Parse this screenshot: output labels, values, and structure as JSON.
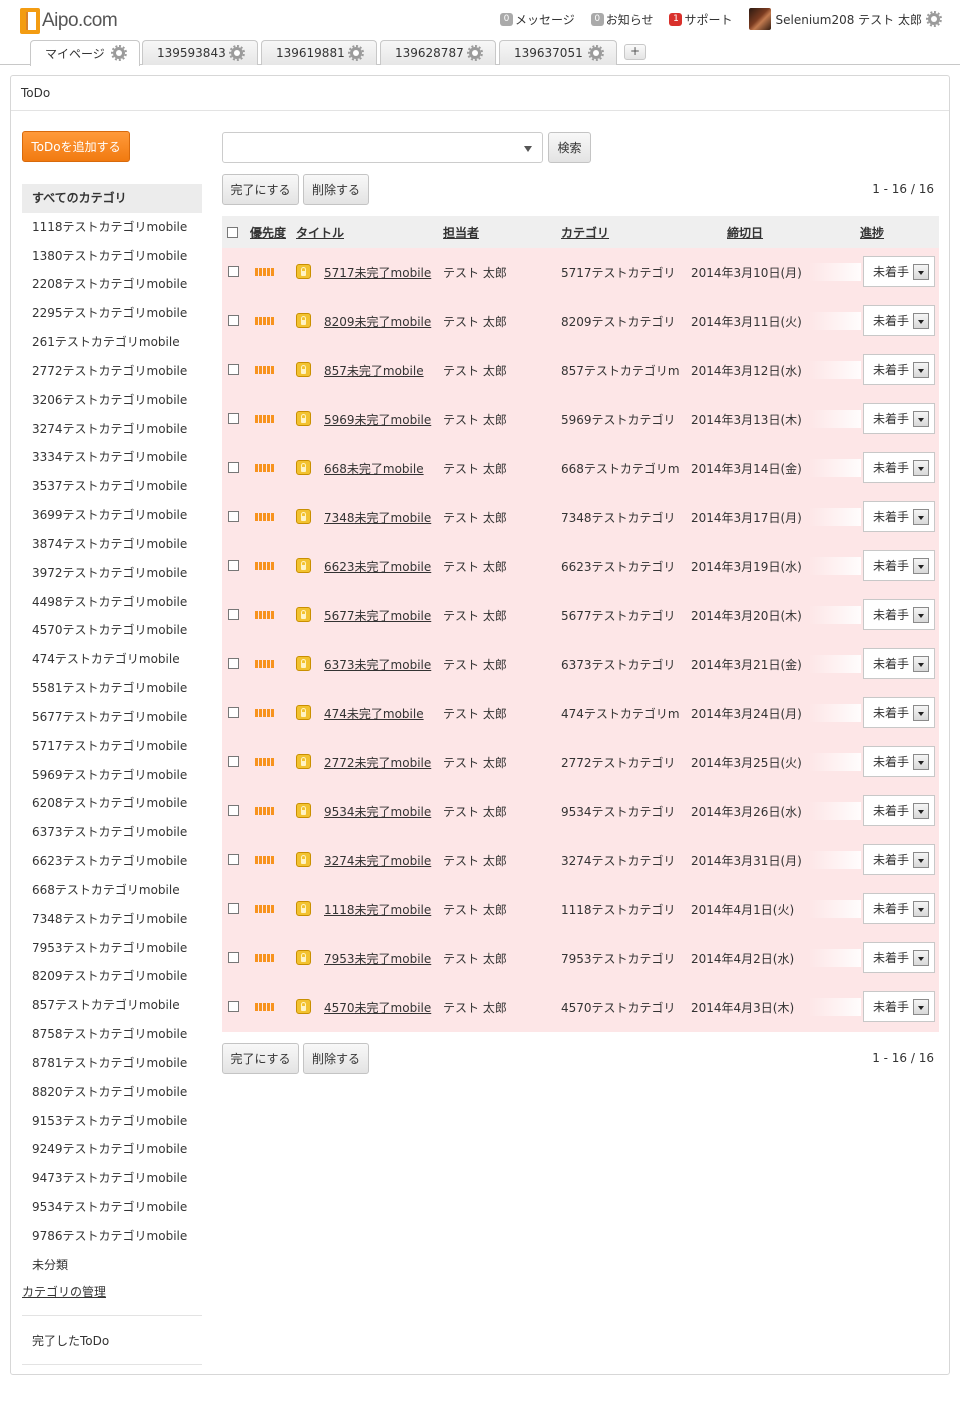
{
  "header": {
    "logo_text": "Aipo.com",
    "links": [
      {
        "badge": "0",
        "label": "メッセージ",
        "badge_color": "#aaaaaa"
      },
      {
        "badge": "0",
        "label": "お知らせ",
        "badge_color": "#aaaaaa"
      },
      {
        "badge": "1",
        "label": "サポート",
        "badge_color": "#d9302b"
      }
    ],
    "user_name": "Selenium208 テスト 太郎"
  },
  "tabs": [
    "マイページ",
    "139593843",
    "139619881",
    "139628787",
    "139637051"
  ],
  "tab_add_label": "+",
  "portlet": {
    "title": "ToDo"
  },
  "sidebar": {
    "add_button": "ToDoを追加する",
    "categories": [
      "すべてのカテゴリ",
      "1118テストカテゴリmobile",
      "1380テストカテゴリmobile",
      "2208テストカテゴリmobile",
      "2295テストカテゴリmobile",
      "261テストカテゴリmobile",
      "2772テストカテゴリmobile",
      "3206テストカテゴリmobile",
      "3274テストカテゴリmobile",
      "3334テストカテゴリmobile",
      "3537テストカテゴリmobile",
      "3699テストカテゴリmobile",
      "3874テストカテゴリmobile",
      "3972テストカテゴリmobile",
      "4498テストカテゴリmobile",
      "4570テストカテゴリmobile",
      "474テストカテゴリmobile",
      "5581テストカテゴリmobile",
      "5677テストカテゴリmobile",
      "5717テストカテゴリmobile",
      "5969テストカテゴリmobile",
      "6208テストカテゴリmobile",
      "6373テストカテゴリmobile",
      "6623テストカテゴリmobile",
      "668テストカテゴリmobile",
      "7348テストカテゴリmobile",
      "7953テストカテゴリmobile",
      "8209テストカテゴリmobile",
      "857テストカテゴリmobile",
      "8758テストカテゴリmobile",
      "8781テストカテゴリmobile",
      "8820テストカテゴリmobile",
      "9153テストカテゴリmobile",
      "9249テストカテゴリmobile",
      "9473テストカテゴリmobile",
      "9534テストカテゴリmobile",
      "9786テストカテゴリmobile",
      "未分類"
    ],
    "manage_link": "カテゴリの管理",
    "completed_link": "完了したToDo"
  },
  "toolbar": {
    "search_button": "検索",
    "complete_button": "完了にする",
    "delete_button": "削除する",
    "pager": "1 - 16 / 16"
  },
  "table": {
    "headers": {
      "priority": "優先度",
      "title": "タイトル",
      "assignee": "担当者",
      "category": "カテゴリ",
      "deadline": "締切日",
      "progress": "進捗"
    },
    "rows": [
      {
        "title": "5717未完了mobile",
        "assignee": "テスト 太郎",
        "category": "5717テストカテゴリ",
        "deadline": "2014年3月10日(月)",
        "status": "未着手"
      },
      {
        "title": "8209未完了mobile",
        "assignee": "テスト 太郎",
        "category": "8209テストカテゴリ",
        "deadline": "2014年3月11日(火)",
        "status": "未着手"
      },
      {
        "title": "857未完了mobile",
        "assignee": "テスト 太郎",
        "category": "857テストカテゴリm",
        "deadline": "2014年3月12日(水)",
        "status": "未着手"
      },
      {
        "title": "5969未完了mobile",
        "assignee": "テスト 太郎",
        "category": "5969テストカテゴリ",
        "deadline": "2014年3月13日(木)",
        "status": "未着手"
      },
      {
        "title": "668未完了mobile",
        "assignee": "テスト 太郎",
        "category": "668テストカテゴリm",
        "deadline": "2014年3月14日(金)",
        "status": "未着手"
      },
      {
        "title": "7348未完了mobile",
        "assignee": "テスト 太郎",
        "category": "7348テストカテゴリ",
        "deadline": "2014年3月17日(月)",
        "status": "未着手"
      },
      {
        "title": "6623未完了mobile",
        "assignee": "テスト 太郎",
        "category": "6623テストカテゴリ",
        "deadline": "2014年3月19日(水)",
        "status": "未着手"
      },
      {
        "title": "5677未完了mobile",
        "assignee": "テスト 太郎",
        "category": "5677テストカテゴリ",
        "deadline": "2014年3月20日(木)",
        "status": "未着手"
      },
      {
        "title": "6373未完了mobile",
        "assignee": "テスト 太郎",
        "category": "6373テストカテゴリ",
        "deadline": "2014年3月21日(金)",
        "status": "未着手"
      },
      {
        "title": "474未完了mobile",
        "assignee": "テスト 太郎",
        "category": "474テストカテゴリm",
        "deadline": "2014年3月24日(月)",
        "status": "未着手"
      },
      {
        "title": "2772未完了mobile",
        "assignee": "テスト 太郎",
        "category": "2772テストカテゴリ",
        "deadline": "2014年3月25日(火)",
        "status": "未着手"
      },
      {
        "title": "9534未完了mobile",
        "assignee": "テスト 太郎",
        "category": "9534テストカテゴリ",
        "deadline": "2014年3月26日(水)",
        "status": "未着手"
      },
      {
        "title": "3274未完了mobile",
        "assignee": "テスト 太郎",
        "category": "3274テストカテゴリ",
        "deadline": "2014年3月31日(月)",
        "status": "未着手"
      },
      {
        "title": "1118未完了mobile",
        "assignee": "テスト 太郎",
        "category": "1118テストカテゴリ",
        "deadline": "2014年4月1日(火)",
        "status": "未着手"
      },
      {
        "title": "7953未完了mobile",
        "assignee": "テスト 太郎",
        "category": "7953テストカテゴリ",
        "deadline": "2014年4月2日(水)",
        "status": "未着手"
      },
      {
        "title": "4570未完了mobile",
        "assignee": "テスト 太郎",
        "category": "4570テストカテゴリ",
        "deadline": "2014年4月3日(木)",
        "status": "未着手"
      }
    ]
  },
  "colors": {
    "accent": "#f17a10",
    "row_bg": "#fde6e7",
    "priority_bar": "#f7931e",
    "lock_icon": "#f2c230"
  },
  "icons": {
    "logo": "door-icon",
    "settings": "gear-icon",
    "priority": "priority-bars-icon",
    "lock": "lock-icon",
    "dropdown": "chevron-down-icon"
  }
}
